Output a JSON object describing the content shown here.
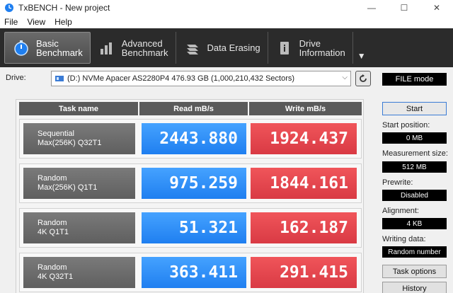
{
  "window": {
    "title": "TxBENCH - New project",
    "minimize_symbol": "—",
    "maximize_symbol": "☐",
    "close_symbol": "✕"
  },
  "menu": [
    "File",
    "View",
    "Help"
  ],
  "toolbar": {
    "items": [
      {
        "label": "Basic\nBenchmark",
        "icon": "stopwatch-icon",
        "active": true
      },
      {
        "label": "Advanced\nBenchmark",
        "icon": "bar-chart-icon",
        "active": false
      },
      {
        "label": "Data Erasing",
        "icon": "eraser-icon",
        "active": false
      },
      {
        "label": "Drive\nInformation",
        "icon": "drive-info-icon",
        "active": false
      }
    ],
    "more_symbol": "▼"
  },
  "drive": {
    "label": "Drive:",
    "value": "(D:) NVMe Apacer AS2280P4  476.93 GB (1,000,210,432 Sectors)",
    "mode": "FILE mode"
  },
  "table": {
    "headers": [
      "Task name",
      "Read mB/s",
      "Write mB/s"
    ],
    "rows": [
      {
        "task": "Sequential\nMax(256K) Q32T1",
        "read": "2443.880",
        "write": "1924.437"
      },
      {
        "task": "Random\nMax(256K) Q1T1",
        "read": "975.259",
        "write": "1844.161"
      },
      {
        "task": "Random\n4K Q1T1",
        "read": "51.321",
        "write": "162.187"
      },
      {
        "task": "Random\n4K Q32T1",
        "read": "363.411",
        "write": "291.415"
      }
    ]
  },
  "panel": {
    "start": "Start",
    "start_position_label": "Start position:",
    "start_position": "0 MB",
    "measurement_size_label": "Measurement size:",
    "measurement_size": "512 MB",
    "prewrite_label": "Prewrite:",
    "prewrite": "Disabled",
    "alignment_label": "Alignment:",
    "alignment": "4 KB",
    "writing_data_label": "Writing data:",
    "writing_data": "Random number",
    "task_options": "Task options",
    "history": "History"
  },
  "colors": {
    "toolbar_bg": "#2b2b2b",
    "read_blue": "#2a8cff",
    "write_red": "#e54850",
    "task_gray": "#6a6a6a"
  }
}
